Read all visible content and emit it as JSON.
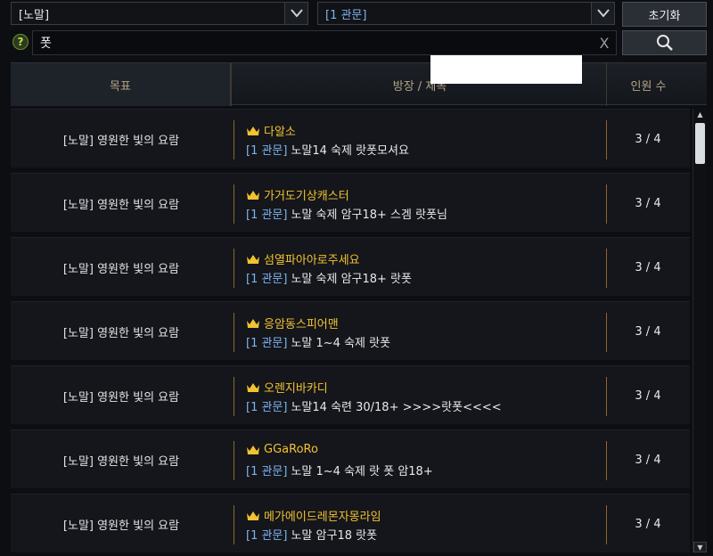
{
  "filters": {
    "difficulty": "[노말]",
    "category": "[1 관문]",
    "reset_label": "초기화"
  },
  "search": {
    "value": "폿",
    "help_label": "?",
    "clear_label": "X"
  },
  "header": {
    "goal": "목표",
    "leader_title": "방장 / 제목",
    "count": "인원 수"
  },
  "rows": [
    {
      "goal": "[노말] 영원한 빛의 요람",
      "leader": "다알소",
      "tag": "[1 관문]",
      "title": "노말14 숙제  랏폿모셔요",
      "count": "3 / 4"
    },
    {
      "goal": "[노말] 영원한 빛의 요람",
      "leader": "가거도기상캐스터",
      "tag": "[1 관문]",
      "title": "노말 숙제 암구18+ 스겜 랏폿님",
      "count": "3 / 4"
    },
    {
      "goal": "[노말] 영원한 빛의 요람",
      "leader": "섬열파아아로주세요",
      "tag": "[1 관문]",
      "title": "노말 숙제 암구18+ 랏폿",
      "count": "3 / 4"
    },
    {
      "goal": "[노말] 영원한 빛의 요람",
      "leader": "응암동스피어맨",
      "tag": "[1 관문]",
      "title": "노말 1~4 숙제 랏폿",
      "count": "3 / 4"
    },
    {
      "goal": "[노말] 영원한 빛의 요람",
      "leader": "오렌지바카디",
      "tag": "[1 관문]",
      "title": "노말14 숙련 30/18+ >>>>랏폿<<<<",
      "count": "3 / 4"
    },
    {
      "goal": "[노말] 영원한 빛의 요람",
      "leader": "GGaRoRo",
      "tag": "[1 관문]",
      "title": "노말 1~4 숙제 랏 폿 암18+",
      "count": "3 / 4"
    },
    {
      "goal": "[노말] 영원한 빛의 요람",
      "leader": "메가에이드레몬자몽라임",
      "tag": "[1 관문]",
      "title": "노말 암구18 랏폿",
      "count": "3 / 4"
    }
  ],
  "colors": {
    "leader": "#f2c230",
    "tag": "#7fb2ec",
    "header_text": "#b3a587"
  }
}
